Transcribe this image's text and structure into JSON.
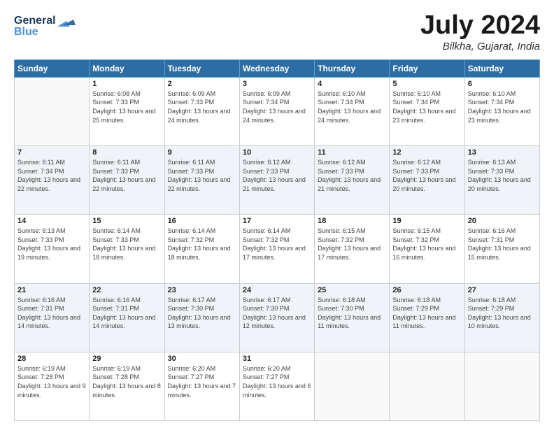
{
  "logo": {
    "line1": "General",
    "line2": "Blue"
  },
  "header": {
    "month_year": "July 2024",
    "location": "Bilkha, Gujarat, India"
  },
  "days_of_week": [
    "Sunday",
    "Monday",
    "Tuesday",
    "Wednesday",
    "Thursday",
    "Friday",
    "Saturday"
  ],
  "weeks": [
    [
      {
        "day": "",
        "sunrise": "",
        "sunset": "",
        "daylight": ""
      },
      {
        "day": "1",
        "sunrise": "Sunrise: 6:08 AM",
        "sunset": "Sunset: 7:33 PM",
        "daylight": "Daylight: 13 hours and 25 minutes."
      },
      {
        "day": "2",
        "sunrise": "Sunrise: 6:09 AM",
        "sunset": "Sunset: 7:33 PM",
        "daylight": "Daylight: 13 hours and 24 minutes."
      },
      {
        "day": "3",
        "sunrise": "Sunrise: 6:09 AM",
        "sunset": "Sunset: 7:34 PM",
        "daylight": "Daylight: 13 hours and 24 minutes."
      },
      {
        "day": "4",
        "sunrise": "Sunrise: 6:10 AM",
        "sunset": "Sunset: 7:34 PM",
        "daylight": "Daylight: 13 hours and 24 minutes."
      },
      {
        "day": "5",
        "sunrise": "Sunrise: 6:10 AM",
        "sunset": "Sunset: 7:34 PM",
        "daylight": "Daylight: 13 hours and 23 minutes."
      },
      {
        "day": "6",
        "sunrise": "Sunrise: 6:10 AM",
        "sunset": "Sunset: 7:34 PM",
        "daylight": "Daylight: 13 hours and 23 minutes."
      }
    ],
    [
      {
        "day": "7",
        "sunrise": "Sunrise: 6:11 AM",
        "sunset": "Sunset: 7:34 PM",
        "daylight": "Daylight: 13 hours and 22 minutes."
      },
      {
        "day": "8",
        "sunrise": "Sunrise: 6:11 AM",
        "sunset": "Sunset: 7:33 PM",
        "daylight": "Daylight: 13 hours and 22 minutes."
      },
      {
        "day": "9",
        "sunrise": "Sunrise: 6:11 AM",
        "sunset": "Sunset: 7:33 PM",
        "daylight": "Daylight: 13 hours and 22 minutes."
      },
      {
        "day": "10",
        "sunrise": "Sunrise: 6:12 AM",
        "sunset": "Sunset: 7:33 PM",
        "daylight": "Daylight: 13 hours and 21 minutes."
      },
      {
        "day": "11",
        "sunrise": "Sunrise: 6:12 AM",
        "sunset": "Sunset: 7:33 PM",
        "daylight": "Daylight: 13 hours and 21 minutes."
      },
      {
        "day": "12",
        "sunrise": "Sunrise: 6:12 AM",
        "sunset": "Sunset: 7:33 PM",
        "daylight": "Daylight: 13 hours and 20 minutes."
      },
      {
        "day": "13",
        "sunrise": "Sunrise: 6:13 AM",
        "sunset": "Sunset: 7:33 PM",
        "daylight": "Daylight: 13 hours and 20 minutes."
      }
    ],
    [
      {
        "day": "14",
        "sunrise": "Sunrise: 6:13 AM",
        "sunset": "Sunset: 7:33 PM",
        "daylight": "Daylight: 13 hours and 19 minutes."
      },
      {
        "day": "15",
        "sunrise": "Sunrise: 6:14 AM",
        "sunset": "Sunset: 7:33 PM",
        "daylight": "Daylight: 13 hours and 18 minutes."
      },
      {
        "day": "16",
        "sunrise": "Sunrise: 6:14 AM",
        "sunset": "Sunset: 7:32 PM",
        "daylight": "Daylight: 13 hours and 18 minutes."
      },
      {
        "day": "17",
        "sunrise": "Sunrise: 6:14 AM",
        "sunset": "Sunset: 7:32 PM",
        "daylight": "Daylight: 13 hours and 17 minutes."
      },
      {
        "day": "18",
        "sunrise": "Sunrise: 6:15 AM",
        "sunset": "Sunset: 7:32 PM",
        "daylight": "Daylight: 13 hours and 17 minutes."
      },
      {
        "day": "19",
        "sunrise": "Sunrise: 6:15 AM",
        "sunset": "Sunset: 7:32 PM",
        "daylight": "Daylight: 13 hours and 16 minutes."
      },
      {
        "day": "20",
        "sunrise": "Sunrise: 6:16 AM",
        "sunset": "Sunset: 7:31 PM",
        "daylight": "Daylight: 13 hours and 15 minutes."
      }
    ],
    [
      {
        "day": "21",
        "sunrise": "Sunrise: 6:16 AM",
        "sunset": "Sunset: 7:31 PM",
        "daylight": "Daylight: 13 hours and 14 minutes."
      },
      {
        "day": "22",
        "sunrise": "Sunrise: 6:16 AM",
        "sunset": "Sunset: 7:31 PM",
        "daylight": "Daylight: 13 hours and 14 minutes."
      },
      {
        "day": "23",
        "sunrise": "Sunrise: 6:17 AM",
        "sunset": "Sunset: 7:30 PM",
        "daylight": "Daylight: 13 hours and 13 minutes."
      },
      {
        "day": "24",
        "sunrise": "Sunrise: 6:17 AM",
        "sunset": "Sunset: 7:30 PM",
        "daylight": "Daylight: 13 hours and 12 minutes."
      },
      {
        "day": "25",
        "sunrise": "Sunrise: 6:18 AM",
        "sunset": "Sunset: 7:30 PM",
        "daylight": "Daylight: 13 hours and 11 minutes."
      },
      {
        "day": "26",
        "sunrise": "Sunrise: 6:18 AM",
        "sunset": "Sunset: 7:29 PM",
        "daylight": "Daylight: 13 hours and 11 minutes."
      },
      {
        "day": "27",
        "sunrise": "Sunrise: 6:18 AM",
        "sunset": "Sunset: 7:29 PM",
        "daylight": "Daylight: 13 hours and 10 minutes."
      }
    ],
    [
      {
        "day": "28",
        "sunrise": "Sunrise: 6:19 AM",
        "sunset": "Sunset: 7:28 PM",
        "daylight": "Daylight: 13 hours and 9 minutes."
      },
      {
        "day": "29",
        "sunrise": "Sunrise: 6:19 AM",
        "sunset": "Sunset: 7:28 PM",
        "daylight": "Daylight: 13 hours and 8 minutes."
      },
      {
        "day": "30",
        "sunrise": "Sunrise: 6:20 AM",
        "sunset": "Sunset: 7:27 PM",
        "daylight": "Daylight: 13 hours and 7 minutes."
      },
      {
        "day": "31",
        "sunrise": "Sunrise: 6:20 AM",
        "sunset": "Sunset: 7:27 PM",
        "daylight": "Daylight: 13 hours and 6 minutes."
      },
      {
        "day": "",
        "sunrise": "",
        "sunset": "",
        "daylight": ""
      },
      {
        "day": "",
        "sunrise": "",
        "sunset": "",
        "daylight": ""
      },
      {
        "day": "",
        "sunrise": "",
        "sunset": "",
        "daylight": ""
      }
    ]
  ]
}
